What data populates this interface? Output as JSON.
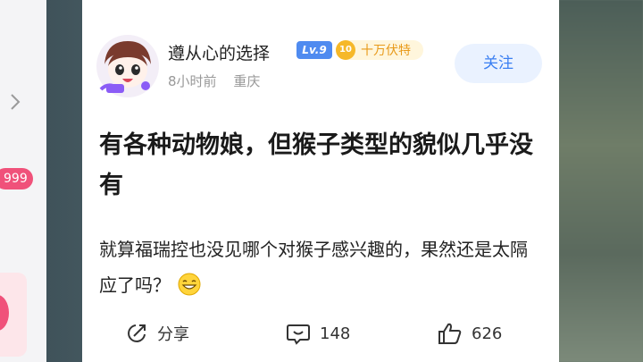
{
  "left_panel": {
    "badge_text": "999"
  },
  "post": {
    "author": {
      "name": "遵从心的选择",
      "level": "Lv.9",
      "fan_rank": "10",
      "fan_title": "十万伏特",
      "time": "8小时前",
      "location": "重庆"
    },
    "follow_label": "关注",
    "title": "有各种动物娘，但猴子类型的貌似几乎没有",
    "body": "就算福瑞控也没见哪个对猴子感兴趣的，果然还是太隔应了吗？",
    "actions": {
      "share_label": "分享",
      "comments": "148",
      "likes": "626"
    }
  },
  "colors": {
    "accent": "#3a7ff2",
    "level_badge": "#4f8bf0",
    "fan_badge": "#f6b829",
    "pink": "#f0517a"
  }
}
